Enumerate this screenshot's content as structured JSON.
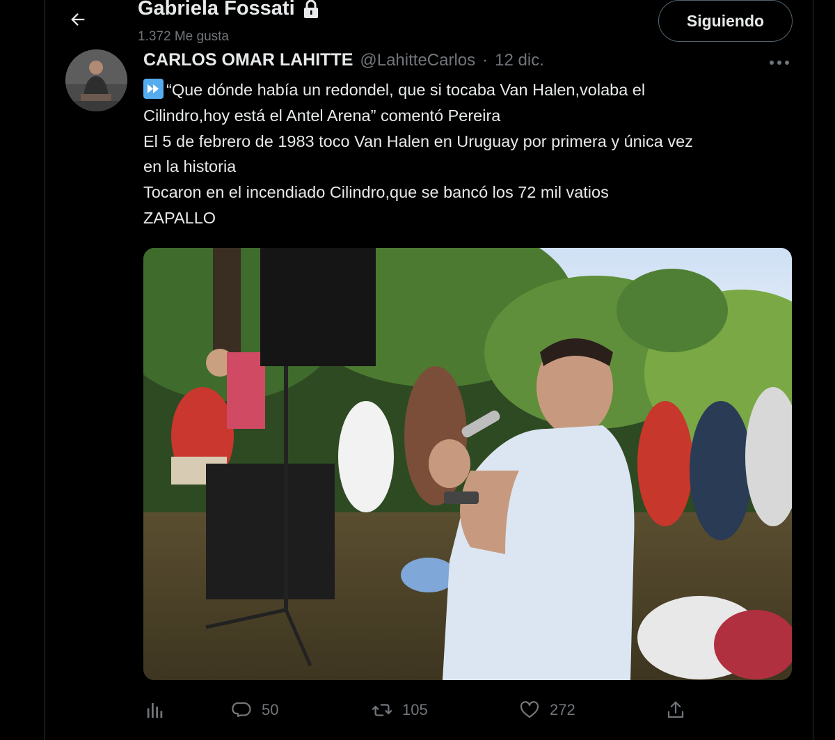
{
  "header": {
    "profile_name": "Gabriela Fossati",
    "likes": "1.372 Me gusta",
    "follow_label": "Siguiendo"
  },
  "tweet": {
    "author_name": "CARLOS OMAR LAHITTE",
    "author_handle": "@LahitteCarlos",
    "separator": "·",
    "date": "12 dic.",
    "lines": [
      "“Que dónde había un redondel, que si tocaba Van Halen,volaba el",
      "Cilindro,hoy está el Antel Arena” comentó Pereira",
      "El 5 de febrero de 1983 toco Van Halen en Uruguay por primera y única vez",
      "en la historia",
      "Tocaron en el  incendiado Cilindro,que se bancó los 72 mil vatios",
      "ZAPALLO"
    ],
    "leading_emoji": "fast-forward-emoji"
  },
  "actions": {
    "analytics": {
      "icon": "analytics-icon"
    },
    "reply": {
      "icon": "reply-icon",
      "count": "50"
    },
    "retweet": {
      "icon": "retweet-icon",
      "count": "105"
    },
    "like": {
      "icon": "heart-icon",
      "count": "272"
    },
    "share": {
      "icon": "share-icon"
    }
  },
  "colors": {
    "background": "#000000",
    "text_primary": "#e7e9ea",
    "text_secondary": "#71767b",
    "border": "#2f3336"
  }
}
